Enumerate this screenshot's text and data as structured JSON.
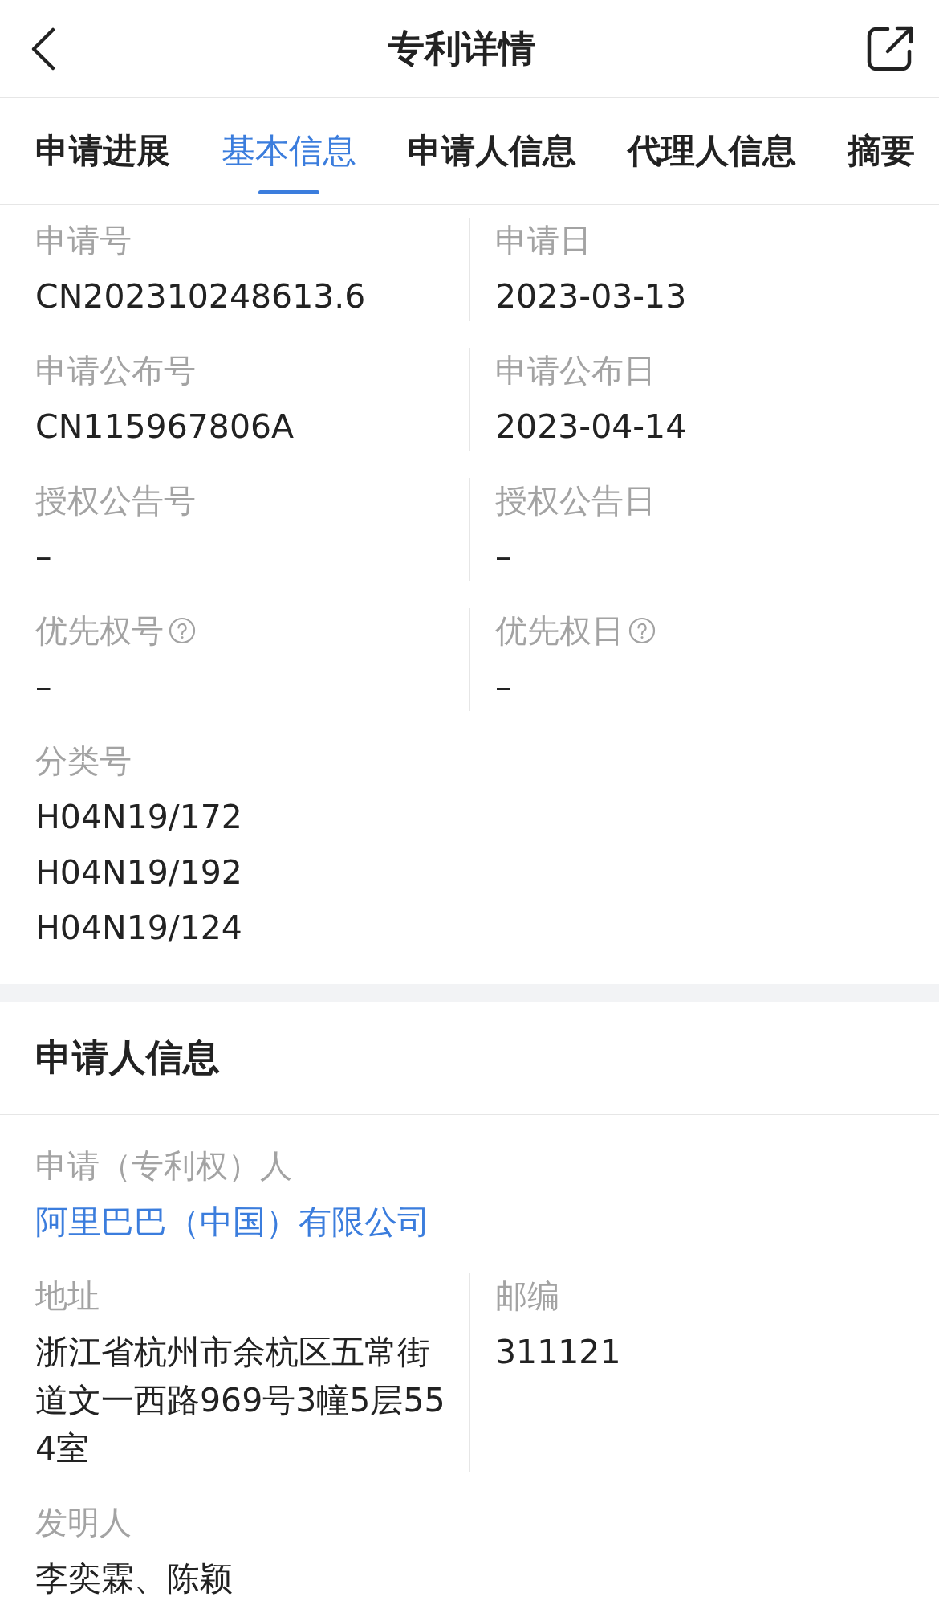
{
  "header": {
    "title": "专利详情"
  },
  "tabs": [
    {
      "label": "申请进展",
      "selected": false
    },
    {
      "label": "基本信息",
      "selected": true
    },
    {
      "label": "申请人信息",
      "selected": false
    },
    {
      "label": "代理人信息",
      "selected": false
    },
    {
      "label": "摘要",
      "selected": false
    }
  ],
  "basic_info": {
    "rows": [
      [
        {
          "label": "申请号",
          "help": false,
          "kind": "text",
          "values": [
            "CN202310248613.6"
          ]
        },
        {
          "label": "申请日",
          "help": false,
          "kind": "text",
          "values": [
            "2023-03-13"
          ]
        }
      ],
      [
        {
          "label": "申请公布号",
          "help": false,
          "kind": "text",
          "values": [
            "CN115967806A"
          ]
        },
        {
          "label": "申请公布日",
          "help": false,
          "kind": "text",
          "values": [
            "2023-04-14"
          ]
        }
      ],
      [
        {
          "label": "授权公告号",
          "help": false,
          "kind": "text",
          "values": [
            "–"
          ]
        },
        {
          "label": "授权公告日",
          "help": false,
          "kind": "text",
          "values": [
            "–"
          ]
        }
      ],
      [
        {
          "label": "优先权号",
          "help": true,
          "kind": "text",
          "values": [
            "–"
          ]
        },
        {
          "label": "优先权日",
          "help": true,
          "kind": "text",
          "values": [
            "–"
          ]
        }
      ],
      [
        {
          "label": "分类号",
          "help": false,
          "kind": "text",
          "values": [
            "H04N19/172",
            "H04N19/192",
            "H04N19/124"
          ]
        }
      ]
    ]
  },
  "applicant_info": {
    "title": "申请人信息",
    "rows": [
      [
        {
          "label": "申请（专利权）人",
          "help": false,
          "kind": "link",
          "values": [
            "阿里巴巴（中国）有限公司"
          ]
        }
      ],
      [
        {
          "label": "地址",
          "help": false,
          "kind": "text",
          "values": [
            "浙江省杭州市余杭区五常街道文一西路969号3幢5层554室"
          ]
        },
        {
          "label": "邮编",
          "help": false,
          "kind": "text",
          "values": [
            "311121"
          ]
        }
      ],
      [
        {
          "label": "发明人",
          "help": false,
          "kind": "text",
          "values": [
            "李奕霖、陈颖"
          ]
        }
      ]
    ]
  }
}
